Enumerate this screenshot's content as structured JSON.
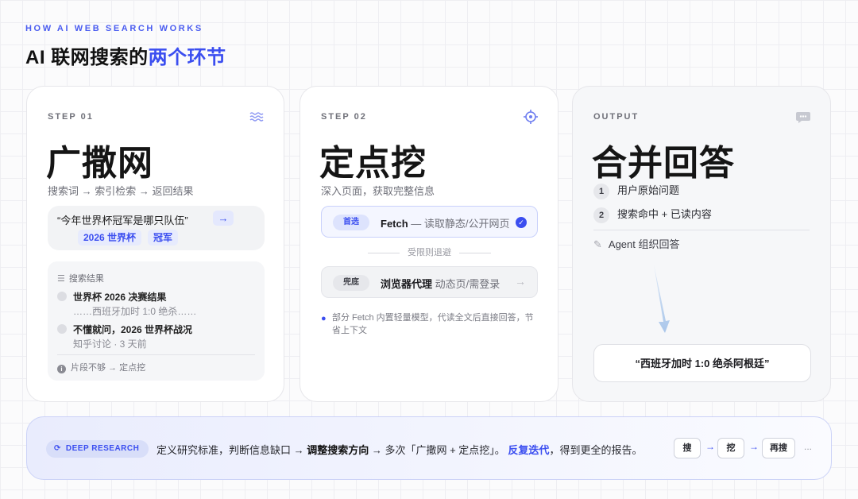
{
  "header": {
    "kicker": "HOW AI WEB SEARCH WORKS",
    "title_plain": "AI 联网搜索的",
    "title_highlight": "两个环节"
  },
  "card1": {
    "step": "STEP 01",
    "icon": "waves-icon",
    "heading": "广撒网",
    "subtitle": "搜索词 → 索引检索 → 返回结果",
    "query": "“今年世界杯冠军是哪只队伍”",
    "query_arrow": "→",
    "tags": [
      "2026 世界杯",
      "冠军"
    ],
    "results_header": "搜索结果",
    "results": [
      {
        "title": "世界杯 2026 决赛结果",
        "snippet": "……西班牙加时 1:0 绝杀……"
      },
      {
        "title": "不懂就问，2026 世界杯战况",
        "snippet": "知乎讨论 · 3 天前"
      }
    ],
    "footer": "片段不够 → 定点挖"
  },
  "card2": {
    "step": "STEP 02",
    "icon": "crosshair-icon",
    "heading": "定点挖",
    "subtitle": "深入页面，获取完整信息",
    "primary_pill": "首选",
    "primary_label": "Fetch",
    "primary_desc": "— 读取静态/公开网页",
    "fallback_divider": "受限则退避",
    "fallback_pill": "兜底",
    "fallback_label": "浏览器代理",
    "fallback_desc": "动态页/需登录",
    "fallback_arrow": "→",
    "note": "部分 Fetch 内置轻量模型，代读全文后直接回答，节省上下文"
  },
  "card3": {
    "step": "OUTPUT",
    "icon": "chat-bubble-icon",
    "heading": "合并回答",
    "items": [
      {
        "num": "1",
        "label": "用户原始问题"
      },
      {
        "num": "2",
        "label": "搜索命中 + 已读内容"
      }
    ],
    "agent_label": "Agent 组织回答",
    "answer": "“西班牙加时 1:0 绝杀阿根廷”"
  },
  "deep_research": {
    "badge": "DEEP RESEARCH",
    "text_1": "定义研究标准，判断信息缺口 → ",
    "text_bold": "调整搜索方向",
    "text_2": " → 多次「广撒网 + 定点挖」。",
    "text_blue": "反复迭代",
    "text_3": "，得到更全的报告。",
    "chips": [
      "搜",
      "挖",
      "再搜"
    ],
    "chip_arrow": "→",
    "ellipsis": "..."
  },
  "colors": {
    "accent": "#3b4ef0",
    "card_bg": "#ffffff",
    "output_bg": "#f6f7f9"
  }
}
